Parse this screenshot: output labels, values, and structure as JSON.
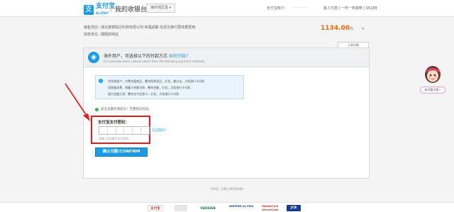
{
  "header": {
    "logo_glyph": "支",
    "logo_text": "支付宝",
    "logo_sub": "ALIPAY",
    "title": "我的收银台",
    "region": "海外地区首 ▾",
    "account_label": "支付宝账户：",
    "account_value": "··············",
    "links": "客人付款 | 一杯一热咖啡 | 95188"
  },
  "order": {
    "line1": "销售供应：·湖北康德锐达科技有限公司·荷福成都·信息交换付费收据费用·",
    "line2": "收款单位：·翱翔前哨站",
    "amount": "1134.00",
    "amount_unit": "元",
    "detail_tab": "订单详情"
  },
  "panel": {
    "title": "海外用户，可选择以下的付款方式",
    "title_link": "如何付款?",
    "title_en": "For overseas users, please select from the following payment methods.",
    "notice_lines": [
      "·供货商账户，付费充值商品，覆充所购货品，红包，集分宝，大陆银行卡付款",
      "·回购服务费、储蓄卡余额付款，覆充余额、红包，大陆银行卡付款",
      "·部分金融工具：覆充支付宝银卡，红包，大陆银行卡付款"
    ],
    "safe_text": "安全设置检测成功！无需短信校验。",
    "pw_label": "支付宝支付密码：",
    "pw_hint": "请输入6位数字支付密码",
    "forgot": "忘记密码?",
    "confirm": "确认付款/CONFIRM"
  },
  "assistant": {
    "bubble": "有问题点我~"
  },
  "footer": {
    "icp": "ICP证：沪B2-20150046",
    "badges": [
      "支付宝",
      "",
      "VERISIGN",
      "VERIFIED by VISA",
      "MasterCard SecureCode",
      "JCB"
    ]
  }
}
